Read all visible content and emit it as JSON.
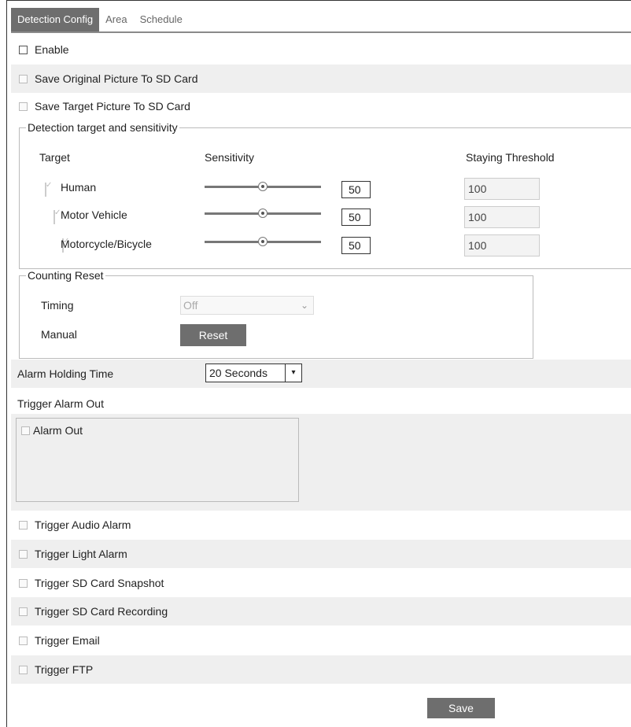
{
  "tabs": [
    "Detection Config",
    "Area",
    "Schedule"
  ],
  "enable_label": "Enable",
  "save_original_label": "Save Original Picture To SD Card",
  "save_target_label": "Save Target Picture To SD Card",
  "detection": {
    "legend": "Detection target and sensitivity",
    "col_target": "Target",
    "col_sensitivity": "Sensitivity",
    "col_threshold": "Staying Threshold",
    "rows": [
      {
        "name": "Human",
        "checked": true,
        "sensitivity": "50",
        "threshold": "100"
      },
      {
        "name": "Motor Vehicle",
        "checked": true,
        "sensitivity": "50",
        "threshold": "100"
      },
      {
        "name": "Motorcycle/Bicycle",
        "checked": true,
        "sensitivity": "50",
        "threshold": "100"
      }
    ]
  },
  "counting": {
    "legend": "Counting Reset",
    "timing_label": "Timing",
    "timing_value": "Off",
    "manual_label": "Manual",
    "reset_label": "Reset"
  },
  "alarm_holding": {
    "label": "Alarm Holding Time",
    "value": "20 Seconds"
  },
  "trigger_alarm_out_label": "Trigger Alarm Out",
  "alarm_out_label": "Alarm Out",
  "triggers": [
    "Trigger Audio Alarm",
    "Trigger Light Alarm",
    "Trigger SD Card Snapshot",
    "Trigger SD Card Recording",
    "Trigger Email",
    "Trigger FTP"
  ],
  "save_label": "Save"
}
